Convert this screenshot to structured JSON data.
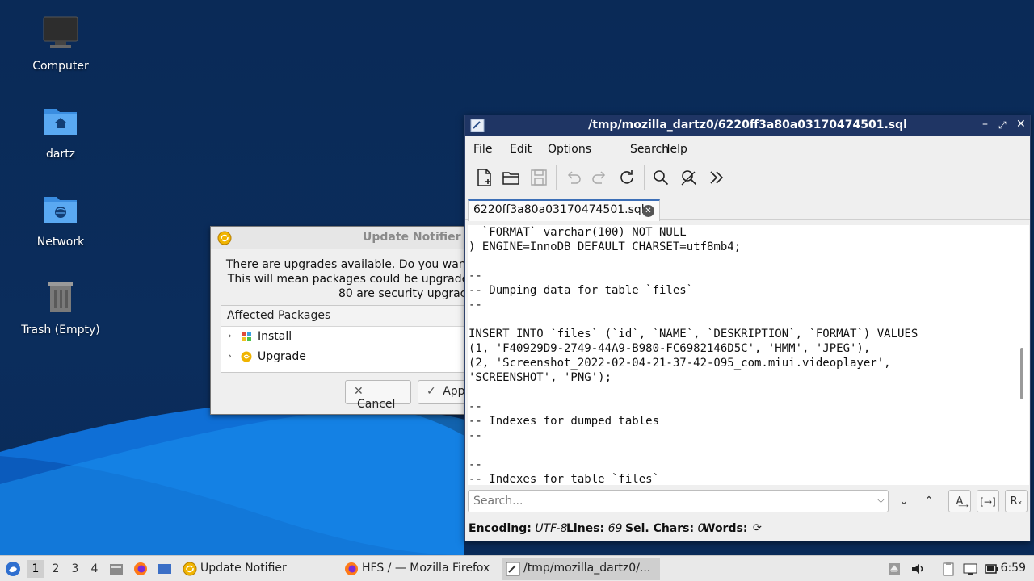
{
  "desktop": {
    "icons": [
      {
        "label": "Computer"
      },
      {
        "label": "dartz"
      },
      {
        "label": "Network"
      },
      {
        "label": "Trash (Empty)"
      }
    ]
  },
  "notifier": {
    "title": "Update Notifier",
    "message_lines": [
      "There are upgrades available. Do you want",
      "This will mean packages could be upgrade",
      "80 are security upgrac"
    ],
    "tree_header": "Affected Packages",
    "tree_items": [
      "Install",
      "Upgrade"
    ],
    "cancel_label": "Cancel",
    "apply_label": "App"
  },
  "editor": {
    "title": "/tmp/mozilla_dartz0/6220ff3a80a03170474501.sql",
    "menu": [
      "File",
      "Edit",
      "Options",
      "Search",
      "Help"
    ],
    "tab_label": "6220ff3a80a03170474501.sql",
    "code_lines": [
      "  `FORMAT` varchar(100) NOT NULL",
      ") ENGINE=InnoDB DEFAULT CHARSET=utf8mb4;",
      "",
      "--",
      "-- Dumping data for table `files`",
      "--",
      "",
      "INSERT INTO `files` (`id`, `NAME`, `DESKRIPTION`, `FORMAT`) VALUES",
      "(1, 'F40929D9-2749-44A9-B980-FC6982146D5C', 'HMM', 'JPEG'),",
      "(2, 'Screenshot_2022-02-04-21-37-42-095_com.miui.videoplayer',",
      "'SCREENSHOT', 'PNG');",
      "",
      "--",
      "-- Indexes for dumped tables",
      "--",
      "",
      "--",
      "-- Indexes for table `files`"
    ],
    "search_placeholder": "Search...",
    "status": {
      "encoding_label": "Encoding:",
      "encoding_value": "UTF-8",
      "lines_label": "Lines:",
      "lines_value": "69",
      "sel_label": "Sel. Chars:",
      "sel_value": "0",
      "words_label": "Words:"
    }
  },
  "taskbar": {
    "workspaces": [
      "1",
      "2",
      "3",
      "4"
    ],
    "tasks": [
      "Update Notifier",
      "HFS / — Mozilla Firefox",
      "/tmp/mozilla_dartz0/..."
    ],
    "clock": "6:59"
  },
  "colors": {
    "desktop_bg": "#0b2d5c",
    "editor_title_bg": "#1f3564",
    "tab_accent": "#3c6fb7"
  }
}
